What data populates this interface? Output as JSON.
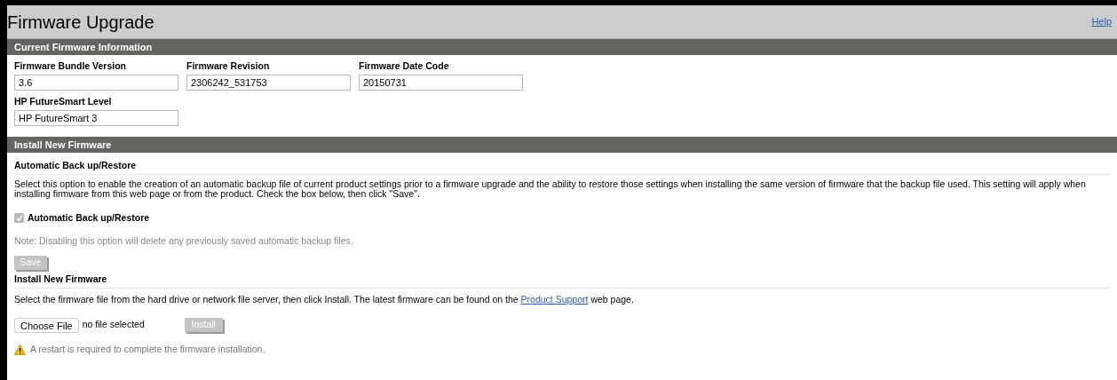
{
  "page": {
    "title": "Firmware Upgrade",
    "help_link": "Help"
  },
  "current_firmware": {
    "header": "Current Firmware Information",
    "fields": [
      {
        "label": "Firmware Bundle Version",
        "value": "3.6"
      },
      {
        "label": "Firmware Revision",
        "value": "2306242_531753"
      },
      {
        "label": "Firmware Date Code",
        "value": "20150731"
      },
      {
        "label": "HP FutureSmart Level",
        "value": "HP FutureSmart 3"
      }
    ]
  },
  "install_section": {
    "header": "Install New Firmware",
    "backup": {
      "heading": "Automatic Back up/Restore",
      "description": "Select this option to enable the creation of an automatic backup file of current product settings prior to a firmware upgrade and the ability to restore those settings when installing the same version of firmware that the backup file used. This setting will apply when installing firmware from this web page or from the product. Check the box below, then click \"Save\".",
      "checkbox": {
        "label": "Automatic Back up/Restore",
        "checked": true,
        "disabled": true
      },
      "note": "Note: Disabling this option will delete any previously saved automatic backup files.",
      "save_button": {
        "label": "Save",
        "disabled": true
      }
    },
    "install": {
      "heading": "Install New Firmware",
      "description_before": "Select the firmware file from the hard drive or network file server, then click Install. The latest firmware can be found on the",
      "link": "Product Support",
      "description_after": "web page.",
      "choose_button": "Choose File",
      "file_status": "no file selected",
      "install_button": {
        "label": "Install",
        "disabled": true
      },
      "warning": "A restart is required to complete the firmware installation."
    }
  }
}
